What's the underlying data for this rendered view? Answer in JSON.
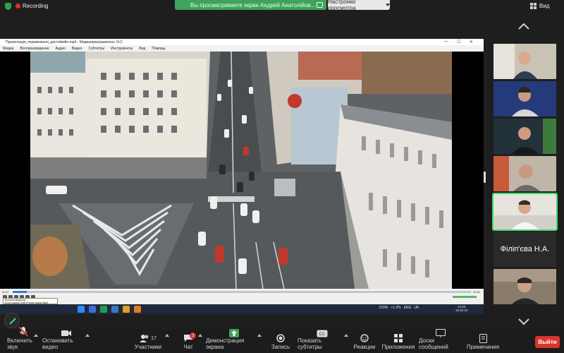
{
  "topbar": {
    "recording_label": "Recording",
    "share_banner": "Вы просматриваете экран Андрей Анатолійов...",
    "view_settings_label": "Настройки просмотра",
    "view_label": "Вид"
  },
  "vlc": {
    "title": "Презентація_перевезення_достойнійн.mp4 - Медиапроигрыватель VLC",
    "menu": [
      "Медиа",
      "Воспроизведение",
      "Аудио",
      "Видео",
      "Субтитры",
      "Инструменты",
      "Вид",
      "Помощь"
    ],
    "time_left": "00:07",
    "time_right": "03:50",
    "progress": 0.03,
    "tooltip_line1": "Воспроизведение",
    "tooltip_line2": "Если нажать Shift+Pause паузы flight",
    "tray_items": [
      "DOW",
      "+1.2%",
      "ENG",
      "UK"
    ],
    "clock_time": "14:00",
    "clock_date": "15.03.24"
  },
  "participants": {
    "name_tile": "Філіп'єва Н.А."
  },
  "toolbar": {
    "mute_label": "Включить звук",
    "stop_video_label": "Остановить видео",
    "participants_label": "Участники",
    "participants_count": "17",
    "chat_label": "Чат",
    "chat_badge": "3",
    "share_label": "Демонстрация экрана",
    "record_label": "Запись",
    "captions_label": "Показать субтитры",
    "reactions_label": "Реакции",
    "apps_label": "Приложения",
    "whiteboards_label": "Доски сообщений",
    "notes_label": "Примечания",
    "leave_label": "Выйти"
  },
  "colors": {
    "share_green": "#3ea45a",
    "active_speaker": "#3ddc70",
    "leave_red": "#d9362e",
    "record_red": "#e02d2d"
  }
}
